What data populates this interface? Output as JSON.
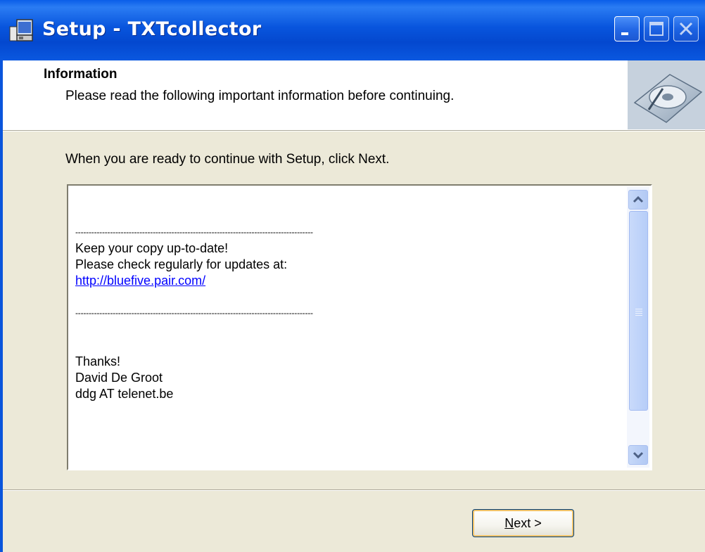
{
  "window": {
    "title": "Setup - TXTcollector"
  },
  "header": {
    "title": "Information",
    "subtitle": "Please read the following important information before continuing."
  },
  "body": {
    "intro": "When you are ready to continue with Setup, click Next.",
    "memo_lines": [
      "-----------------------------------------------------------------------------------------",
      "Keep your copy up-to-date!",
      "Please check regularly for updates at:",
      "http://bluefive.pair.com/",
      "-----------------------------------------------------------------------------------------",
      "Thanks!",
      "David De Groot",
      "ddg AT telenet.be"
    ]
  },
  "footer": {
    "next_mnemonic": "N",
    "next_rest": "ext >"
  },
  "colors": {
    "titlebar": "#0855dd",
    "window_bg": "#ece9d8",
    "link": "#0000ff"
  }
}
